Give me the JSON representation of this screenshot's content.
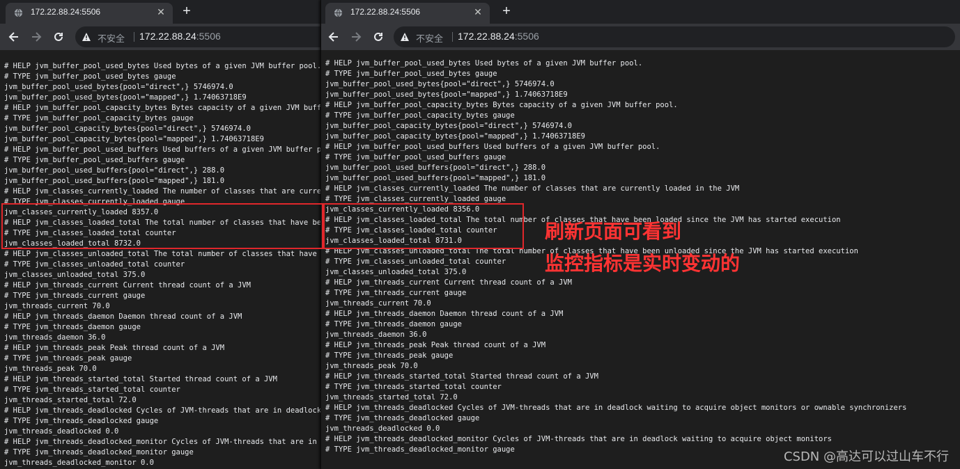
{
  "left_window": {
    "tab_title": "172.22.88.24:5506",
    "insecure_label": "不安全",
    "url_host": "172.22.88.24",
    "url_port": ":5506",
    "metrics": "# HELP jvm_buffer_pool_used_bytes Used bytes of a given JVM buffer pool.\n# TYPE jvm_buffer_pool_used_bytes gauge\njvm_buffer_pool_used_bytes{pool=\"direct\",} 5746974.0\njvm_buffer_pool_used_bytes{pool=\"mapped\",} 1.74063718E9\n# HELP jvm_buffer_pool_capacity_bytes Bytes capacity of a given JVM buffer pool.\n# TYPE jvm_buffer_pool_capacity_bytes gauge\njvm_buffer_pool_capacity_bytes{pool=\"direct\",} 5746974.0\njvm_buffer_pool_capacity_bytes{pool=\"mapped\",} 1.74063718E9\n# HELP jvm_buffer_pool_used_buffers Used buffers of a given JVM buffer pool.\n# TYPE jvm_buffer_pool_used_buffers gauge\njvm_buffer_pool_used_buffers{pool=\"direct\",} 288.0\njvm_buffer_pool_used_buffers{pool=\"mapped\",} 181.0\n# HELP jvm_classes_currently_loaded The number of classes that are currently loaded in the JVM\n# TYPE jvm_classes_currently_loaded gauge\njvm_classes_currently_loaded 8357.0\n# HELP jvm_classes_loaded_total The total number of classes that have been loaded since the JVM has started execution\n# TYPE jvm_classes_loaded_total counter\njvm_classes_loaded_total 8732.0\n# HELP jvm_classes_unloaded_total The total number of classes that have been unloaded since the JVM has started execution\n# TYPE jvm_classes_unloaded_total counter\njvm_classes_unloaded_total 375.0\n# HELP jvm_threads_current Current thread count of a JVM\n# TYPE jvm_threads_current gauge\njvm_threads_current 70.0\n# HELP jvm_threads_daemon Daemon thread count of a JVM\n# TYPE jvm_threads_daemon gauge\njvm_threads_daemon 36.0\n# HELP jvm_threads_peak Peak thread count of a JVM\n# TYPE jvm_threads_peak gauge\njvm_threads_peak 70.0\n# HELP jvm_threads_started_total Started thread count of a JVM\n# TYPE jvm_threads_started_total counter\njvm_threads_started_total 72.0\n# HELP jvm_threads_deadlocked Cycles of JVM-threads that are in deadlock waiting to acquire object monitors or ownable synchronizers\n# TYPE jvm_threads_deadlocked gauge\njvm_threads_deadlocked 0.0\n# HELP jvm_threads_deadlocked_monitor Cycles of JVM-threads that are in deadlock waiting to acquire object monitors\n# TYPE jvm_threads_deadlocked_monitor gauge\njvm_threads_deadlocked_monitor 0.0"
  },
  "right_window": {
    "tab_title": "172.22.88.24:5506",
    "insecure_label": "不安全",
    "url_host": "172.22.88.24",
    "url_port": ":5506",
    "metrics": "# HELP jvm_buffer_pool_used_bytes Used bytes of a given JVM buffer pool.\n# TYPE jvm_buffer_pool_used_bytes gauge\njvm_buffer_pool_used_bytes{pool=\"direct\",} 5746974.0\njvm_buffer_pool_used_bytes{pool=\"mapped\",} 1.74063718E9\n# HELP jvm_buffer_pool_capacity_bytes Bytes capacity of a given JVM buffer pool.\n# TYPE jvm_buffer_pool_capacity_bytes gauge\njvm_buffer_pool_capacity_bytes{pool=\"direct\",} 5746974.0\njvm_buffer_pool_capacity_bytes{pool=\"mapped\",} 1.74063718E9\n# HELP jvm_buffer_pool_used_buffers Used buffers of a given JVM buffer pool.\n# TYPE jvm_buffer_pool_used_buffers gauge\njvm_buffer_pool_used_buffers{pool=\"direct\",} 288.0\njvm_buffer_pool_used_buffers{pool=\"mapped\",} 181.0\n# HELP jvm_classes_currently_loaded The number of classes that are currently loaded in the JVM\n# TYPE jvm_classes_currently_loaded gauge\njvm_classes_currently_loaded 8356.0\n# HELP jvm_classes_loaded_total The total number of classes that have been loaded since the JVM has started execution\n# TYPE jvm_classes_loaded_total counter\njvm_classes_loaded_total 8731.0\n# HELP jvm_classes_unloaded_total The total number of classes that have been unloaded since the JVM has started execution\n# TYPE jvm_classes_unloaded_total counter\njvm_classes_unloaded_total 375.0\n# HELP jvm_threads_current Current thread count of a JVM\n# TYPE jvm_threads_current gauge\njvm_threads_current 70.0\n# HELP jvm_threads_daemon Daemon thread count of a JVM\n# TYPE jvm_threads_daemon gauge\njvm_threads_daemon 36.0\n# HELP jvm_threads_peak Peak thread count of a JVM\n# TYPE jvm_threads_peak gauge\njvm_threads_peak 70.0\n# HELP jvm_threads_started_total Started thread count of a JVM\n# TYPE jvm_threads_started_total counter\njvm_threads_started_total 72.0\n# HELP jvm_threads_deadlocked Cycles of JVM-threads that are in deadlock waiting to acquire object monitors or ownable synchronizers\n# TYPE jvm_threads_deadlocked gauge\njvm_threads_deadlocked 0.0\n# HELP jvm_threads_deadlocked_monitor Cycles of JVM-threads that are in deadlock waiting to acquire object monitors\n# TYPE jvm_threads_deadlocked_monitor gauge"
  },
  "annotation": {
    "line1": "刷新页面可看到",
    "line2": "监控指标是实时变动的",
    "color": "#ff3333"
  },
  "watermark": "CSDN @高达可以过山车不行",
  "icons": {
    "tab": "globe-icon",
    "new_tab": "plus-icon",
    "back": "arrow-left-icon",
    "forward": "arrow-right-icon",
    "reload": "reload-icon",
    "security": "warning-triangle-icon",
    "close": "close-icon"
  },
  "colors": {
    "highlight_box": "#e0272b",
    "page_background": "#1e1e1e",
    "toolbar": "#35363a"
  }
}
